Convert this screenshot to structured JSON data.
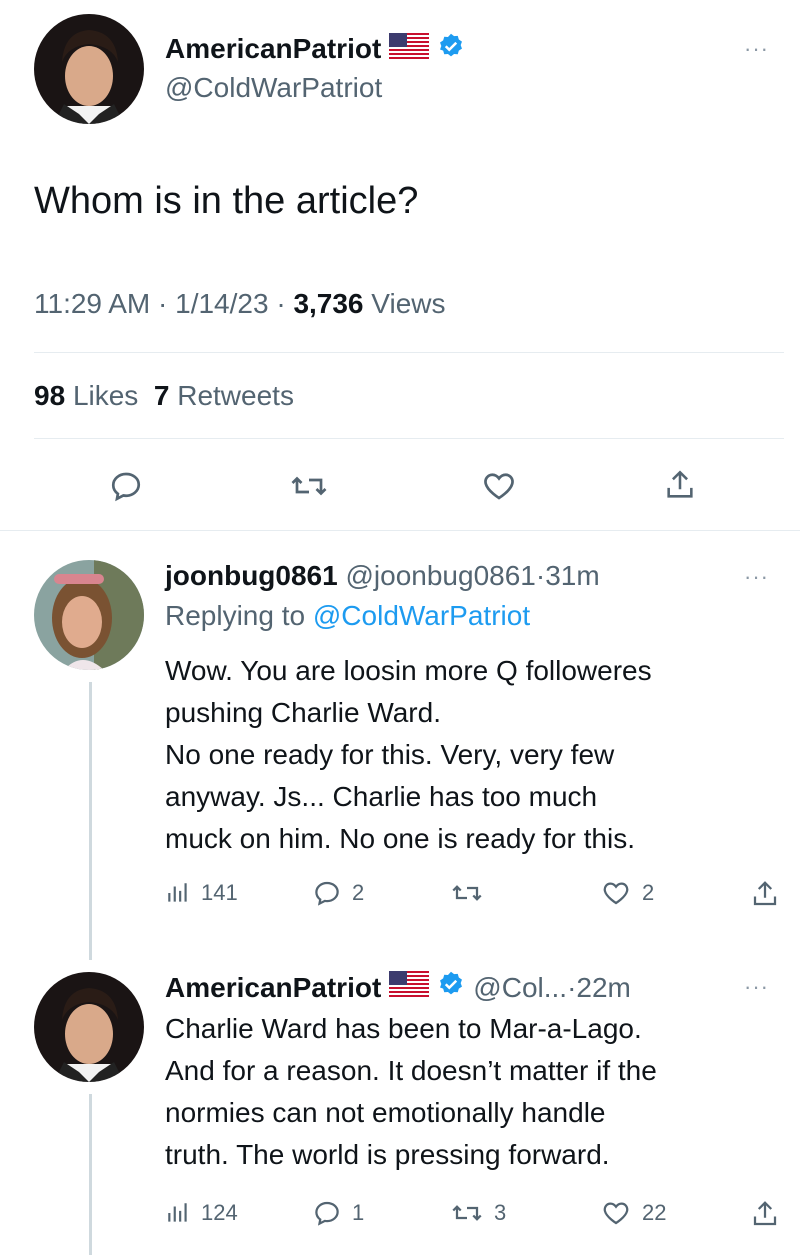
{
  "main_tweet": {
    "display_name": "AmericanPatriot",
    "handle": "@ColdWarPatriot",
    "text": "Whom is in the article?",
    "time": "11:29 AM",
    "date": "1/14/23",
    "views_count": "3,736",
    "views_label": "Views",
    "likes_count": "98",
    "likes_label": "Likes",
    "retweets_count": "7",
    "retweets_label": "Retweets",
    "more": "···"
  },
  "replies": [
    {
      "display_name": "joonbug0861",
      "handle": "@joonbug0861",
      "time": "31m",
      "replying_label": "Replying to",
      "replying_to": "@ColdWarPatriot",
      "text": "Wow.  You are loosin more Q followeres\npushing Charlie Ward.\nNo one ready for this.  Very, very few\nanyway.   Js...  Charlie has too much\nmuck on him.  No one is ready for this.",
      "views": "141",
      "replies": "2",
      "retweets": "",
      "likes": "2",
      "more": "···"
    },
    {
      "display_name": "AmericanPatriot",
      "handle": "@Col...",
      "time": "22m",
      "text": "Charlie Ward has been to Mar-a-Lago.\nAnd for a reason. It doesn’t matter if the\nnormies can not emotionally handle\ntruth. The world is pressing forward.",
      "views": "124",
      "replies": "1",
      "retweets": "3",
      "likes": "22",
      "more": "···"
    }
  ],
  "separator": "·",
  "colors": {
    "accent": "#1d9bf0",
    "muted": "#536471",
    "text": "#0f1419"
  }
}
